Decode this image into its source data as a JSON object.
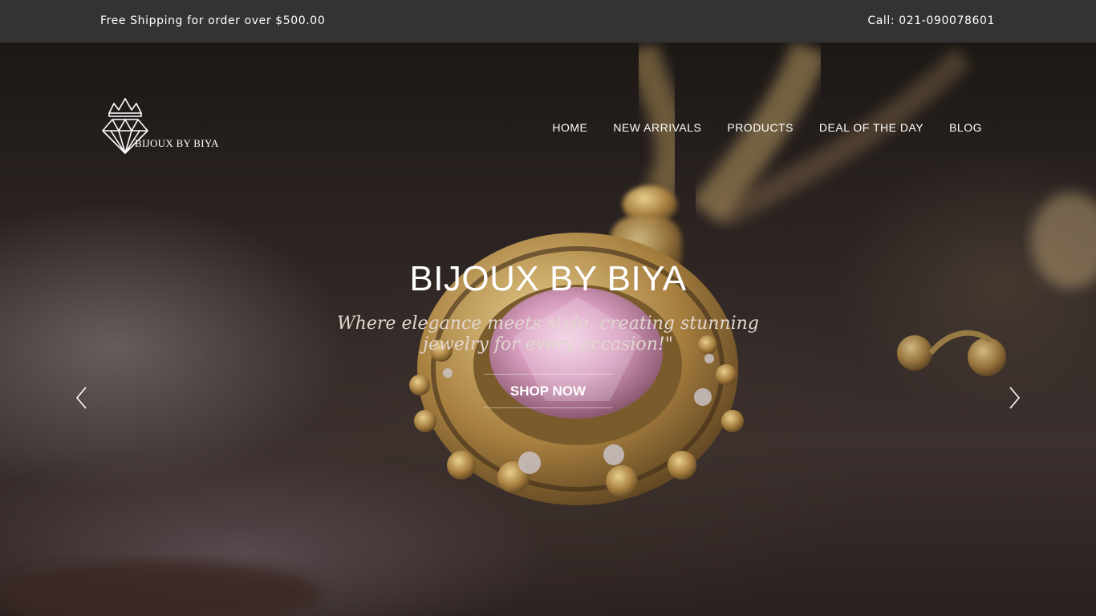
{
  "topbar": {
    "shipping_text": "Free Shipping for order over $500.00",
    "phone_text": "Call: 021-090078601"
  },
  "brand": {
    "logo_text": "BIJOUX BY BIYA",
    "logo_icon": "diamond-crown-icon"
  },
  "nav": {
    "items": [
      {
        "label": "HOME"
      },
      {
        "label": "NEW ARRIVALS"
      },
      {
        "label": "PRODUCTS"
      },
      {
        "label": "DEAL OF THE DAY"
      },
      {
        "label": "BLOG"
      }
    ]
  },
  "hero": {
    "title": "BIJOUX BY BIYA",
    "tagline": "Where elegance meets style, creating stunning jewelry for every occasion!\"",
    "cta_label": "SHOP NOW",
    "prev_icon": "chevron-left-icon",
    "next_icon": "chevron-right-icon"
  },
  "colors": {
    "topbar_bg": "#333333",
    "text": "#ffffff",
    "gold": "#b8944f",
    "gem": "#d9a3c3"
  }
}
